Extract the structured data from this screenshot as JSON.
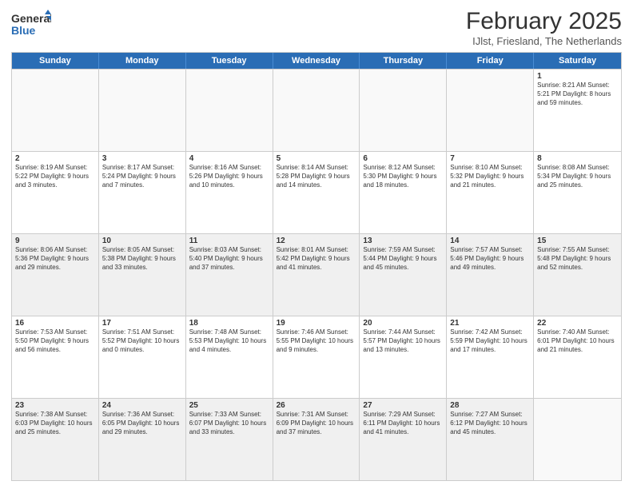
{
  "logo": {
    "general": "General",
    "blue": "Blue"
  },
  "header": {
    "title": "February 2025",
    "subtitle": "IJlst, Friesland, The Netherlands"
  },
  "weekdays": [
    "Sunday",
    "Monday",
    "Tuesday",
    "Wednesday",
    "Thursday",
    "Friday",
    "Saturday"
  ],
  "rows": [
    [
      {
        "day": "",
        "text": "",
        "empty": true
      },
      {
        "day": "",
        "text": "",
        "empty": true
      },
      {
        "day": "",
        "text": "",
        "empty": true
      },
      {
        "day": "",
        "text": "",
        "empty": true
      },
      {
        "day": "",
        "text": "",
        "empty": true
      },
      {
        "day": "",
        "text": "",
        "empty": true
      },
      {
        "day": "1",
        "text": "Sunrise: 8:21 AM\nSunset: 5:21 PM\nDaylight: 8 hours and 59 minutes.",
        "empty": false
      }
    ],
    [
      {
        "day": "2",
        "text": "Sunrise: 8:19 AM\nSunset: 5:22 PM\nDaylight: 9 hours and 3 minutes.",
        "empty": false
      },
      {
        "day": "3",
        "text": "Sunrise: 8:17 AM\nSunset: 5:24 PM\nDaylight: 9 hours and 7 minutes.",
        "empty": false
      },
      {
        "day": "4",
        "text": "Sunrise: 8:16 AM\nSunset: 5:26 PM\nDaylight: 9 hours and 10 minutes.",
        "empty": false
      },
      {
        "day": "5",
        "text": "Sunrise: 8:14 AM\nSunset: 5:28 PM\nDaylight: 9 hours and 14 minutes.",
        "empty": false
      },
      {
        "day": "6",
        "text": "Sunrise: 8:12 AM\nSunset: 5:30 PM\nDaylight: 9 hours and 18 minutes.",
        "empty": false
      },
      {
        "day": "7",
        "text": "Sunrise: 8:10 AM\nSunset: 5:32 PM\nDaylight: 9 hours and 21 minutes.",
        "empty": false
      },
      {
        "day": "8",
        "text": "Sunrise: 8:08 AM\nSunset: 5:34 PM\nDaylight: 9 hours and 25 minutes.",
        "empty": false
      }
    ],
    [
      {
        "day": "9",
        "text": "Sunrise: 8:06 AM\nSunset: 5:36 PM\nDaylight: 9 hours and 29 minutes.",
        "empty": false
      },
      {
        "day": "10",
        "text": "Sunrise: 8:05 AM\nSunset: 5:38 PM\nDaylight: 9 hours and 33 minutes.",
        "empty": false
      },
      {
        "day": "11",
        "text": "Sunrise: 8:03 AM\nSunset: 5:40 PM\nDaylight: 9 hours and 37 minutes.",
        "empty": false
      },
      {
        "day": "12",
        "text": "Sunrise: 8:01 AM\nSunset: 5:42 PM\nDaylight: 9 hours and 41 minutes.",
        "empty": false
      },
      {
        "day": "13",
        "text": "Sunrise: 7:59 AM\nSunset: 5:44 PM\nDaylight: 9 hours and 45 minutes.",
        "empty": false
      },
      {
        "day": "14",
        "text": "Sunrise: 7:57 AM\nSunset: 5:46 PM\nDaylight: 9 hours and 49 minutes.",
        "empty": false
      },
      {
        "day": "15",
        "text": "Sunrise: 7:55 AM\nSunset: 5:48 PM\nDaylight: 9 hours and 52 minutes.",
        "empty": false
      }
    ],
    [
      {
        "day": "16",
        "text": "Sunrise: 7:53 AM\nSunset: 5:50 PM\nDaylight: 9 hours and 56 minutes.",
        "empty": false
      },
      {
        "day": "17",
        "text": "Sunrise: 7:51 AM\nSunset: 5:52 PM\nDaylight: 10 hours and 0 minutes.",
        "empty": false
      },
      {
        "day": "18",
        "text": "Sunrise: 7:48 AM\nSunset: 5:53 PM\nDaylight: 10 hours and 4 minutes.",
        "empty": false
      },
      {
        "day": "19",
        "text": "Sunrise: 7:46 AM\nSunset: 5:55 PM\nDaylight: 10 hours and 9 minutes.",
        "empty": false
      },
      {
        "day": "20",
        "text": "Sunrise: 7:44 AM\nSunset: 5:57 PM\nDaylight: 10 hours and 13 minutes.",
        "empty": false
      },
      {
        "day": "21",
        "text": "Sunrise: 7:42 AM\nSunset: 5:59 PM\nDaylight: 10 hours and 17 minutes.",
        "empty": false
      },
      {
        "day": "22",
        "text": "Sunrise: 7:40 AM\nSunset: 6:01 PM\nDaylight: 10 hours and 21 minutes.",
        "empty": false
      }
    ],
    [
      {
        "day": "23",
        "text": "Sunrise: 7:38 AM\nSunset: 6:03 PM\nDaylight: 10 hours and 25 minutes.",
        "empty": false
      },
      {
        "day": "24",
        "text": "Sunrise: 7:36 AM\nSunset: 6:05 PM\nDaylight: 10 hours and 29 minutes.",
        "empty": false
      },
      {
        "day": "25",
        "text": "Sunrise: 7:33 AM\nSunset: 6:07 PM\nDaylight: 10 hours and 33 minutes.",
        "empty": false
      },
      {
        "day": "26",
        "text": "Sunrise: 7:31 AM\nSunset: 6:09 PM\nDaylight: 10 hours and 37 minutes.",
        "empty": false
      },
      {
        "day": "27",
        "text": "Sunrise: 7:29 AM\nSunset: 6:11 PM\nDaylight: 10 hours and 41 minutes.",
        "empty": false
      },
      {
        "day": "28",
        "text": "Sunrise: 7:27 AM\nSunset: 6:12 PM\nDaylight: 10 hours and 45 minutes.",
        "empty": false
      },
      {
        "day": "",
        "text": "",
        "empty": true
      }
    ]
  ]
}
